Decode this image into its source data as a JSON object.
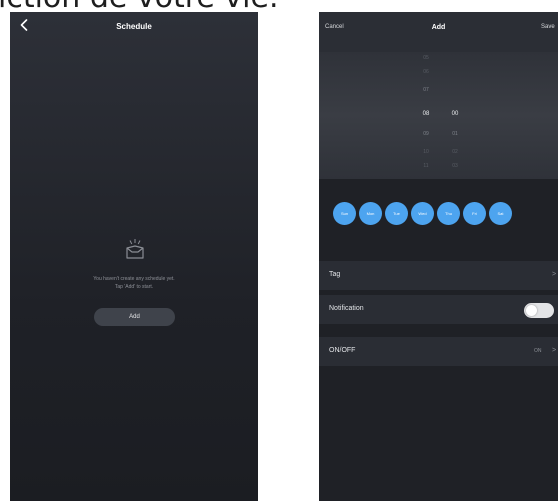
{
  "caption": "iction de votre vie.",
  "colors": {
    "accent": "#4da4ef",
    "background": "#1f2126",
    "row_background": "#2a2d34"
  },
  "schedule_screen": {
    "title": "Schedule",
    "back_icon": "chevron-left-icon",
    "empty_icon": "empty-tray-icon",
    "empty_line_1": "You haven't create any schedule yet.",
    "empty_line_2": "Tap 'Add' to start.",
    "add_label": "Add"
  },
  "add_screen": {
    "cancel_label": "Cancel",
    "title": "Add",
    "save_label": "Save",
    "picker": {
      "hours": [
        "05",
        "06",
        "07",
        "08",
        "09",
        "10",
        "11"
      ],
      "minutes": [
        "00",
        "01",
        "02",
        "03"
      ],
      "selected_hour": "08",
      "selected_minute": "00"
    },
    "days": [
      "Sun",
      "Mon",
      "Tue",
      "Wed",
      "Thu",
      "Fri",
      "Sat"
    ],
    "tag_label": "Tag",
    "notification_label": "Notification",
    "notification_enabled": false,
    "onoff_label": "ON/OFF",
    "onoff_value": "ON",
    "chevron": ">"
  }
}
